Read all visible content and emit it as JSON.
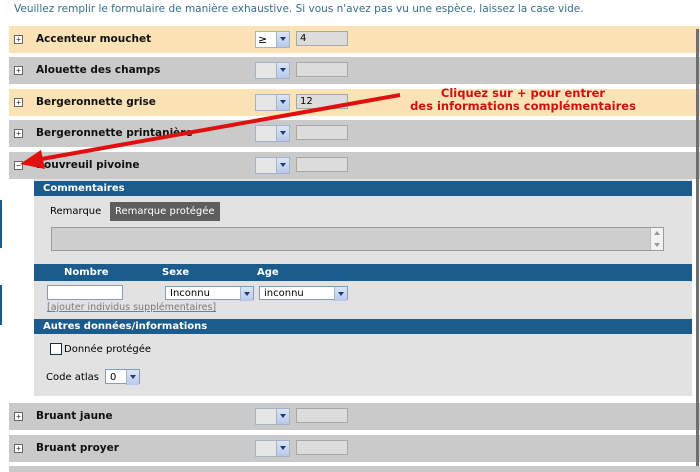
{
  "intro": "Veuillez remplir le formulaire de manière exhaustive. Si vous n'avez pas vu une espèce, laissez la case vide.",
  "species": [
    {
      "name": "Accenteur mouchet",
      "expander": "+",
      "operator": "≥",
      "count": "4"
    },
    {
      "name": "Alouette des champs",
      "expander": "+",
      "operator": "",
      "count": ""
    },
    {
      "name": "Bergeronnette grise",
      "expander": "+",
      "operator": "",
      "count": "12"
    },
    {
      "name": "Bergeronnette printanière",
      "expander": "+",
      "operator": "",
      "count": ""
    },
    {
      "name": "Bouvreuil pivoine",
      "expander": "−",
      "operator": "",
      "count": ""
    },
    {
      "name": "Bruant jaune",
      "expander": "+",
      "operator": "",
      "count": ""
    },
    {
      "name": "Bruant proyer",
      "expander": "+",
      "operator": "",
      "count": ""
    }
  ],
  "detail": {
    "comments_header": "Commentaires",
    "tabs": [
      "Remarque",
      "Remarque protégée"
    ],
    "columns": [
      "Nombre",
      "Sexe",
      "Age"
    ],
    "sexe_value": "Inconnu",
    "age_value": "inconnu",
    "add_link": "[ajouter individus supplémentaires]",
    "other_header": "Autres données/informations",
    "protected_label": "Donnée protégée",
    "atlas_label": "Code atlas",
    "atlas_value": "0"
  },
  "annotation": {
    "line1": "Cliquez sur + pour entrer",
    "line2": "des informations complémentaires",
    "color": "#d01010"
  },
  "colors": {
    "highlight_row": "#fbe3b6",
    "grey_row": "#cacaca",
    "band": "#1b5c8c"
  }
}
